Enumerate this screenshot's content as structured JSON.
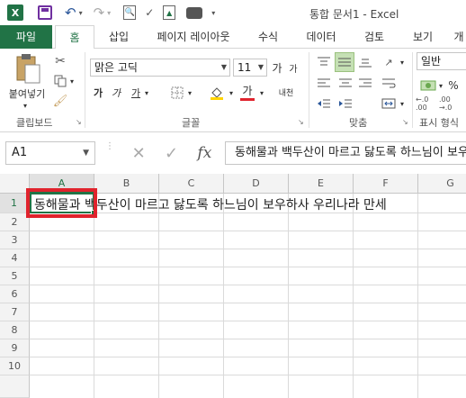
{
  "title_bar": {
    "title": "통합 문서1 - Excel"
  },
  "tabs": [
    "파일",
    "홈",
    "삽입",
    "페이지 레이아웃",
    "수식",
    "데이터",
    "검토",
    "보기",
    "개"
  ],
  "ribbon": {
    "paste_label": "붙여넣기",
    "font_name": "맑은 고딕",
    "font_size": "11",
    "grow_font": "가",
    "shrink_font": "가",
    "bold": "가",
    "italic": "가",
    "underline": "가",
    "font_color_glyph": "가",
    "phonetic": "내천",
    "number_format": "일반",
    "groups": [
      "클립보드",
      "글꼴",
      "맞춤",
      "표시 형식"
    ],
    "accent_color": "#217346",
    "highlight_color": "#e0232d"
  },
  "formula_bar": {
    "name_box": "A1",
    "fx": "fx",
    "content": "동해물과 백두산이 마르고 닳도록 하느님이 보우하사 우리나라 만세"
  },
  "sheet": {
    "columns": [
      "A",
      "B",
      "C",
      "D",
      "E",
      "F",
      "G"
    ],
    "rows": [
      "1",
      "2",
      "3",
      "4",
      "5",
      "6",
      "7",
      "8",
      "9",
      "10"
    ],
    "a1_value": "동해물과 백두산이 마르고 닳도록 하느님이 보우하사 우리나라 만세"
  }
}
